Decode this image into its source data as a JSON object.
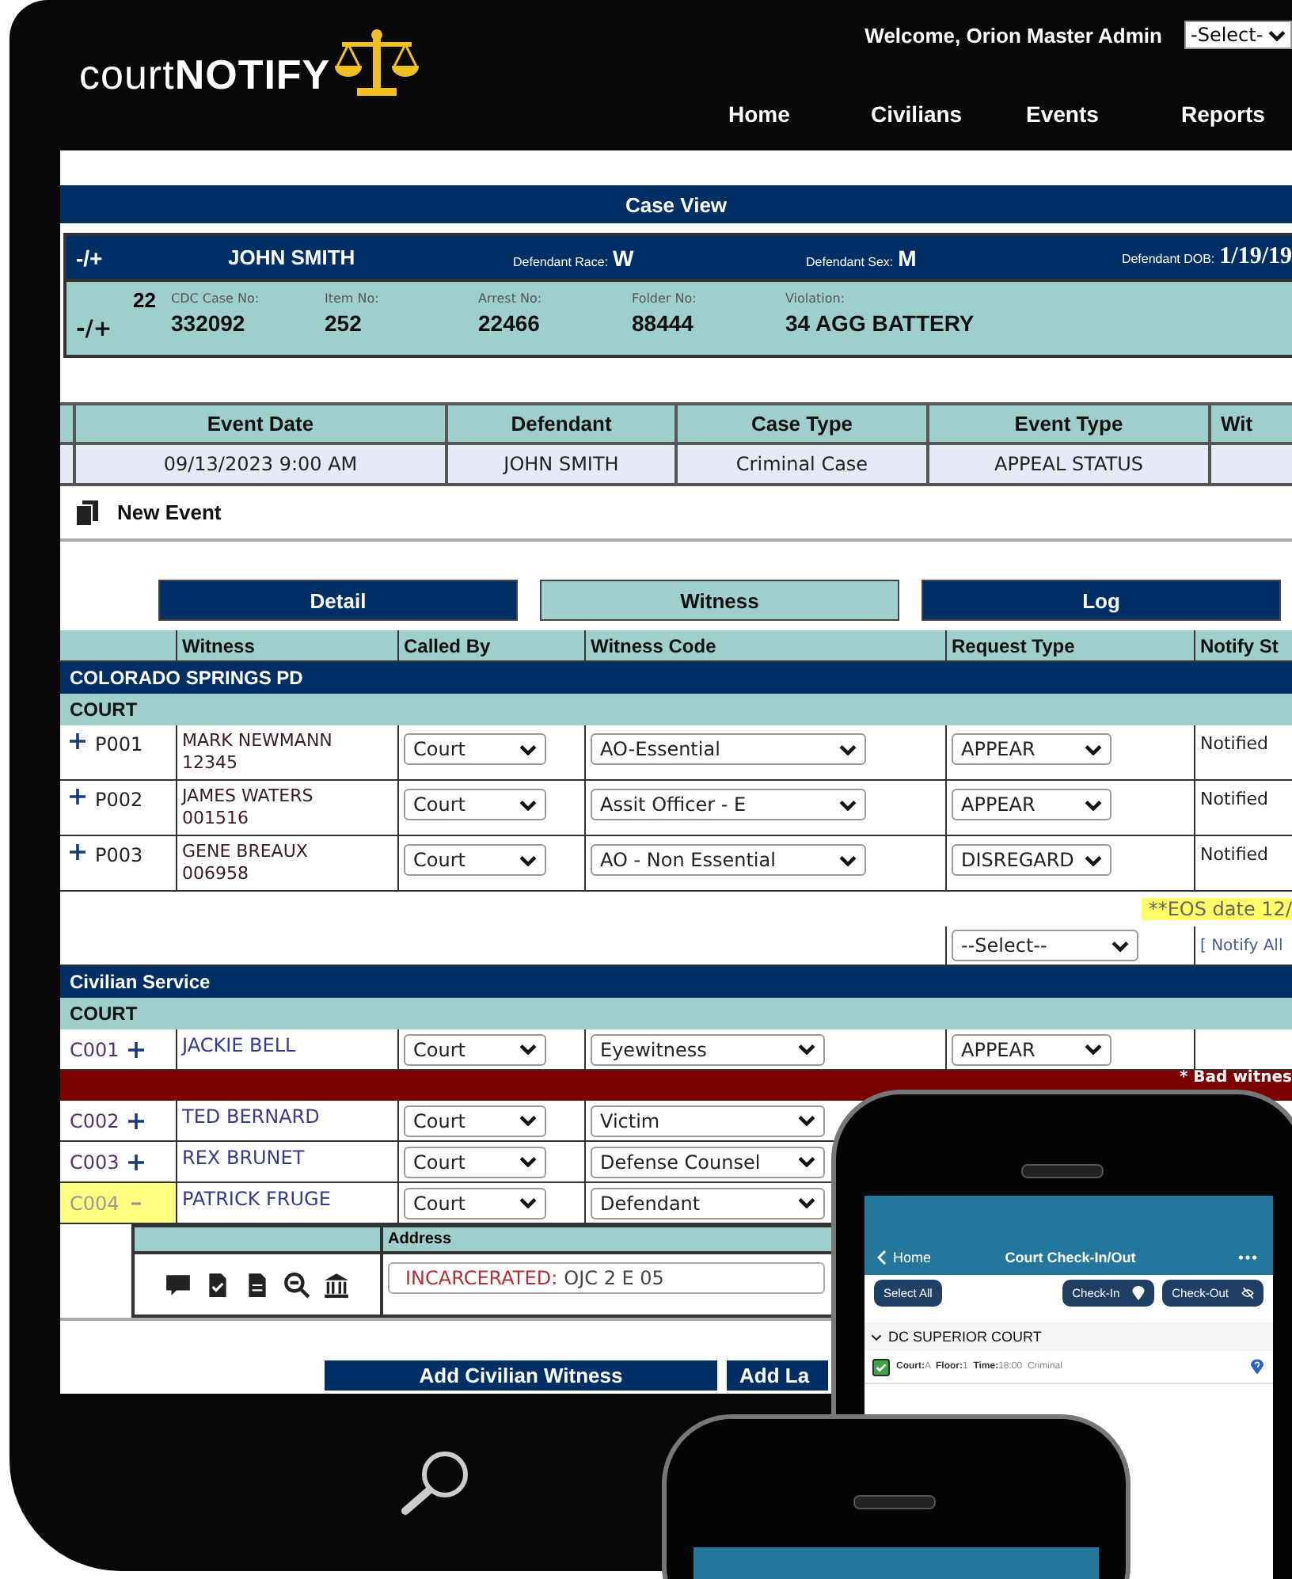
{
  "header": {
    "logo": "court**NOTIFY**",
    "welcome": "Welcome, Orion Master Admin",
    "role_select": "-Select-",
    "nav": [
      {
        "label": "Home"
      },
      {
        "label": "Civilians"
      },
      {
        "label": "Events"
      },
      {
        "label": "Reports"
      }
    ]
  },
  "case_view": {
    "title": "Case View",
    "defendant": {
      "toggle": "-/+",
      "name": "JOHN SMITH",
      "fields": [
        {
          "label": "Defendant Race:",
          "value": "W"
        },
        {
          "label": "Defendant Sex:",
          "value": "M"
        },
        {
          "label": "Defendant DOB:",
          "value": "1/19/19"
        }
      ]
    },
    "case": {
      "toggle": "-/+",
      "count": "22",
      "fields": [
        {
          "label": "CDC Case No:",
          "value": "332092"
        },
        {
          "label": "Item No:",
          "value": "252"
        },
        {
          "label": "Arrest No:",
          "value": "22466"
        },
        {
          "label": "Folder No:",
          "value": "88444"
        },
        {
          "label": "Violation:",
          "value": "34 AGG BATTERY"
        }
      ]
    }
  },
  "events": {
    "columns": [
      "Event Date",
      "Defendant",
      "Case Type",
      "Event Type",
      "Wit"
    ],
    "rows": [
      [
        "09/13/2023 9:00 AM",
        "JOHN SMITH",
        "Criminal Case",
        "APPEAL STATUS"
      ]
    ]
  },
  "new_event": "New Event",
  "tabs": [
    {
      "label": "Detail",
      "selected": false
    },
    {
      "label": "Witness",
      "selected": true
    },
    {
      "label": "Log",
      "selected": false
    }
  ],
  "witness_table": {
    "columns": [
      "Witness",
      "Called By",
      "Witness Code",
      "Request Type",
      "Notify St"
    ],
    "agency": {
      "title": "COLORADO SPRINGS PD",
      "group": "COURT",
      "rows": [
        {
          "id": "P001",
          "expanded": false,
          "name": "MARK NEWMANN",
          "number": "12345",
          "called_by": "Court",
          "code": "AO-Essential",
          "request": "APPEAR",
          "status": "Notified"
        },
        {
          "id": "P002",
          "expanded": false,
          "name": "JAMES WATERS",
          "number": "001516",
          "called_by": "Court",
          "code": "Assit Officer - E",
          "request": "APPEAR",
          "status": "Notified"
        },
        {
          "id": "P003",
          "expanded": false,
          "name": "GENE BREAUX",
          "number": "006958",
          "called_by": "Court",
          "code": "AO - Non Essential",
          "request": "DISREGARD",
          "status": "Notified"
        }
      ],
      "eos_note": "**EOS date 12/",
      "bulk_select": "--Select--",
      "notify_all": "[ Notify All"
    },
    "civilian": {
      "title": "Civilian Service",
      "group": "COURT",
      "rows": [
        {
          "kind": "witness",
          "id": "C001",
          "expanded": false,
          "selected": false,
          "name": "JACKIE BELL",
          "called_by": "Court",
          "code": "Eyewitness",
          "request": "APPEAR"
        },
        {
          "kind": "warning",
          "text": "* Bad witnes"
        },
        {
          "kind": "witness",
          "id": "C002",
          "expanded": false,
          "selected": false,
          "name": "TED BERNARD",
          "called_by": "Court",
          "code": "Victim"
        },
        {
          "kind": "witness",
          "id": "C003",
          "expanded": false,
          "selected": false,
          "name": "REX BRUNET",
          "called_by": "Court",
          "code": "Defense Counsel"
        },
        {
          "kind": "witness",
          "id": "C004",
          "expanded": true,
          "selected": true,
          "name": "PATRICK FRUGE",
          "called_by": "Court",
          "code": "Defendant",
          "detail": {
            "address_label": "Address",
            "status": "INCARCERATED:",
            "address": "OJC 2 E 05"
          }
        }
      ]
    }
  },
  "buttons": [
    "Add Civilian Witness",
    "Add La"
  ],
  "phone": {
    "back": "Home",
    "title": "Court Check-In/Out",
    "buttons": [
      "Select All",
      "Check-In",
      "Check-Out"
    ],
    "group": {
      "title": "DC SUPERIOR COURT",
      "expanded": true,
      "items": [
        {
          "checked": true,
          "text": "**Court:**A  **Floor:**1  **Time:**18:00  Criminal"
        }
      ]
    }
  }
}
